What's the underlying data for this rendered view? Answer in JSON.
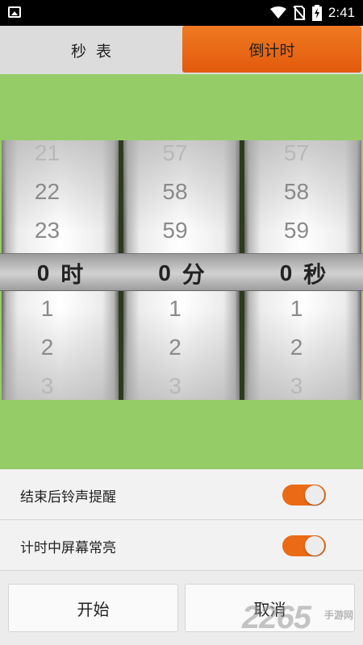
{
  "status_bar": {
    "time": "2:41",
    "icons": [
      "image-notification-icon",
      "wifi-icon",
      "no-sim-icon",
      "battery-charging-icon"
    ]
  },
  "tabs": [
    {
      "label": "秒  表",
      "selected": false
    },
    {
      "label": "倒计时",
      "selected": true
    }
  ],
  "picker": {
    "hours": {
      "above": [
        "21",
        "22",
        "23"
      ],
      "value": "0",
      "unit": "时",
      "below": [
        "1",
        "2",
        "3"
      ]
    },
    "minutes": {
      "above": [
        "57",
        "58",
        "59"
      ],
      "value": "0",
      "unit": "分",
      "below": [
        "1",
        "2",
        "3"
      ]
    },
    "seconds": {
      "above": [
        "57",
        "58",
        "59"
      ],
      "value": "0",
      "unit": "秒",
      "below": [
        "1",
        "2",
        "3"
      ]
    }
  },
  "settings": [
    {
      "label": "结束后铃声提醒",
      "on": true
    },
    {
      "label": "计时中屏幕常亮",
      "on": true
    }
  ],
  "buttons": {
    "start": "开始",
    "cancel": "取消"
  },
  "watermark": {
    "text": "2265",
    "suffix": "手游网"
  },
  "colors": {
    "accent": "#e8650f",
    "green": "#96cc68",
    "toggle_on": "#ea6a16"
  }
}
